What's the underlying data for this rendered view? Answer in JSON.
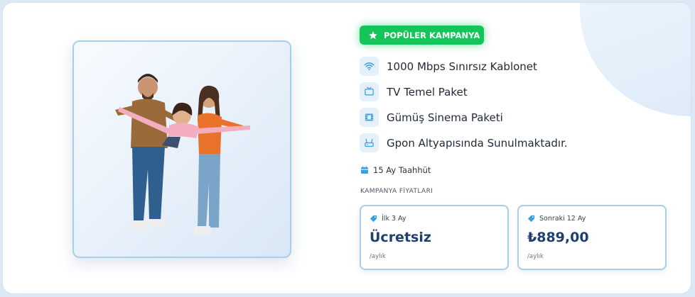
{
  "campaign": {
    "badge": "POPÜLER KAMPANYA",
    "features": [
      {
        "icon": "wifi-icon",
        "label": "1000 Mbps Sınırsız Kablonet"
      },
      {
        "icon": "tv-icon",
        "label": "TV Temel Paket"
      },
      {
        "icon": "film-icon",
        "label": "Gümüş Sinema Paketi"
      },
      {
        "icon": "router-icon",
        "label": "Gpon Altyapısında Sunulmaktadır."
      }
    ],
    "commitment": "15 Ay Taahhüt",
    "prices_heading": "KAMPANYA FİYATLARI",
    "prices": [
      {
        "period": "İlk 3 Ay",
        "value": "Ücretsiz",
        "unit": "/aylık"
      },
      {
        "period": "Sonraki 12 Ay",
        "value": "₺889,00",
        "unit": "/aylık"
      }
    ]
  },
  "colors": {
    "accent_green": "#14c65a",
    "accent_blue": "#3a9fe0",
    "price_text": "#1f3f6e",
    "border": "#a6cfe9"
  }
}
